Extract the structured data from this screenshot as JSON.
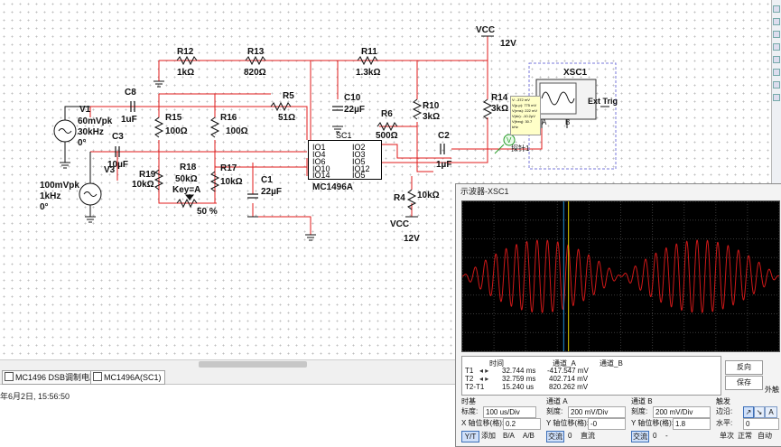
{
  "schematic": {
    "components": {
      "r12": {
        "name": "R12",
        "value": "1kΩ"
      },
      "r13": {
        "name": "R13",
        "value": "820Ω"
      },
      "r11": {
        "name": "R11",
        "value": "1.3kΩ"
      },
      "r5": {
        "name": "R5",
        "value": "51Ω"
      },
      "r15": {
        "name": "R15",
        "value": "100Ω"
      },
      "r16": {
        "name": "R16",
        "value": "100Ω"
      },
      "r10": {
        "name": "R10",
        "value": "3kΩ"
      },
      "r14": {
        "name": "R14",
        "value": "3kΩ"
      },
      "r6": {
        "name": "R6",
        "value": "500Ω"
      },
      "r19": {
        "name": "R19",
        "value": "10kΩ"
      },
      "r17": {
        "name": "R17",
        "value": "10kΩ"
      },
      "r18": {
        "name": "R18",
        "value": "50kΩ",
        "key": "Key=A",
        "percent": "50 %"
      },
      "r4": {
        "name": "R4",
        "value": "10kΩ"
      },
      "c8": {
        "name": "C8",
        "value": "1uF"
      },
      "c3": {
        "name": "C3",
        "value": "10µF"
      },
      "c10": {
        "name": "C10",
        "value": "22µF"
      },
      "c1": {
        "name": "C1",
        "value": "22µF"
      },
      "c2": {
        "name": "C2",
        "value": "1µF"
      },
      "v1": {
        "name": "V1",
        "amp": "60mVpk",
        "freq": "30kHz",
        "phase": "0°"
      },
      "v3": {
        "name": "V3",
        "amp": "100mVpk",
        "freq": "1kHz",
        "phase": "0°"
      },
      "vcc_top": {
        "name": "VCC",
        "value": "12V"
      },
      "vcc_bottom": {
        "name": "VCC",
        "value": "12V"
      },
      "ic": {
        "ref": "SC1",
        "part": "MC1496A",
        "pins": [
          "IO1",
          "IO2",
          "IO4",
          "IO3",
          "IO6",
          "IO5",
          "IO10",
          "IO12",
          "IO14",
          "IO5"
        ]
      },
      "xsc1": {
        "name": "XSC1",
        "ext": "Ext Trig",
        "chA": "A",
        "chB": "B"
      },
      "probe": {
        "label": "探针1",
        "symbol": "V"
      },
      "probe_tip": [
        "V: -372 mV",
        "V(p-p): 775 mV",
        "V(rms): 222 mV",
        "V(dc): -10.2μV",
        "V(freq): 30.7 kHz"
      ]
    }
  },
  "tabs": [
    {
      "label": "MC1496 DSB调制电路"
    },
    {
      "label": "MC1496A(SC1)"
    }
  ],
  "status": {
    "timestamp": "年6月2日, 15:56:50"
  },
  "right_edge": {
    "label": "外触"
  },
  "scope": {
    "title": "示波器-XSC1",
    "readout": {
      "headers": {
        "time": "时间",
        "chA": "通道_A",
        "chB": "通道_B"
      },
      "rows": [
        {
          "label": "T1",
          "time": "32.744 ms",
          "a": "-417.547 mV",
          "b": ""
        },
        {
          "label": "T2",
          "time": "32.759 ms",
          "a": "402.714 mV",
          "b": ""
        },
        {
          "label": "T2-T1",
          "time": "15.240 us",
          "a": "820.262 mV",
          "b": ""
        }
      ]
    },
    "buttons": {
      "reverse": "反向",
      "save": "保存"
    },
    "timebase": {
      "section": "时基",
      "scale_label": "标度:",
      "scale": "100 us/Div",
      "xpos_label": "X 轴位移(格):",
      "xpos": "0.2",
      "modes": [
        "Y/T",
        "添加",
        "B/A",
        "A/B"
      ]
    },
    "channel_a": {
      "section": "通道 A",
      "scale_label": "刻度:",
      "scale": "200 mV/Div",
      "ypos_label": "Y 轴位移(格):",
      "ypos": "-0",
      "coupling": [
        "交流",
        "0",
        "直流"
      ]
    },
    "channel_b": {
      "section": "通道 B",
      "scale_label": "刻度:",
      "scale": "200 mV/Div",
      "ypos_label": "Y 轴位移(格):",
      "ypos": "1.8",
      "coupling": [
        "交流",
        "0",
        "-"
      ]
    },
    "trigger": {
      "section": "触发",
      "edge_label": "边沿:",
      "edge_a": "A",
      "level_label": "水平:",
      "level": "0",
      "modes": [
        "单次",
        "正常",
        "自动"
      ]
    },
    "waveform": {
      "carrier_khz": 30.7,
      "modulation_khz": 1,
      "peak_mv": 387,
      "trace_color": "#d01818",
      "cursor_t1_color": "#1f8fd8",
      "cursor_t2_color": "#e0d000"
    }
  }
}
